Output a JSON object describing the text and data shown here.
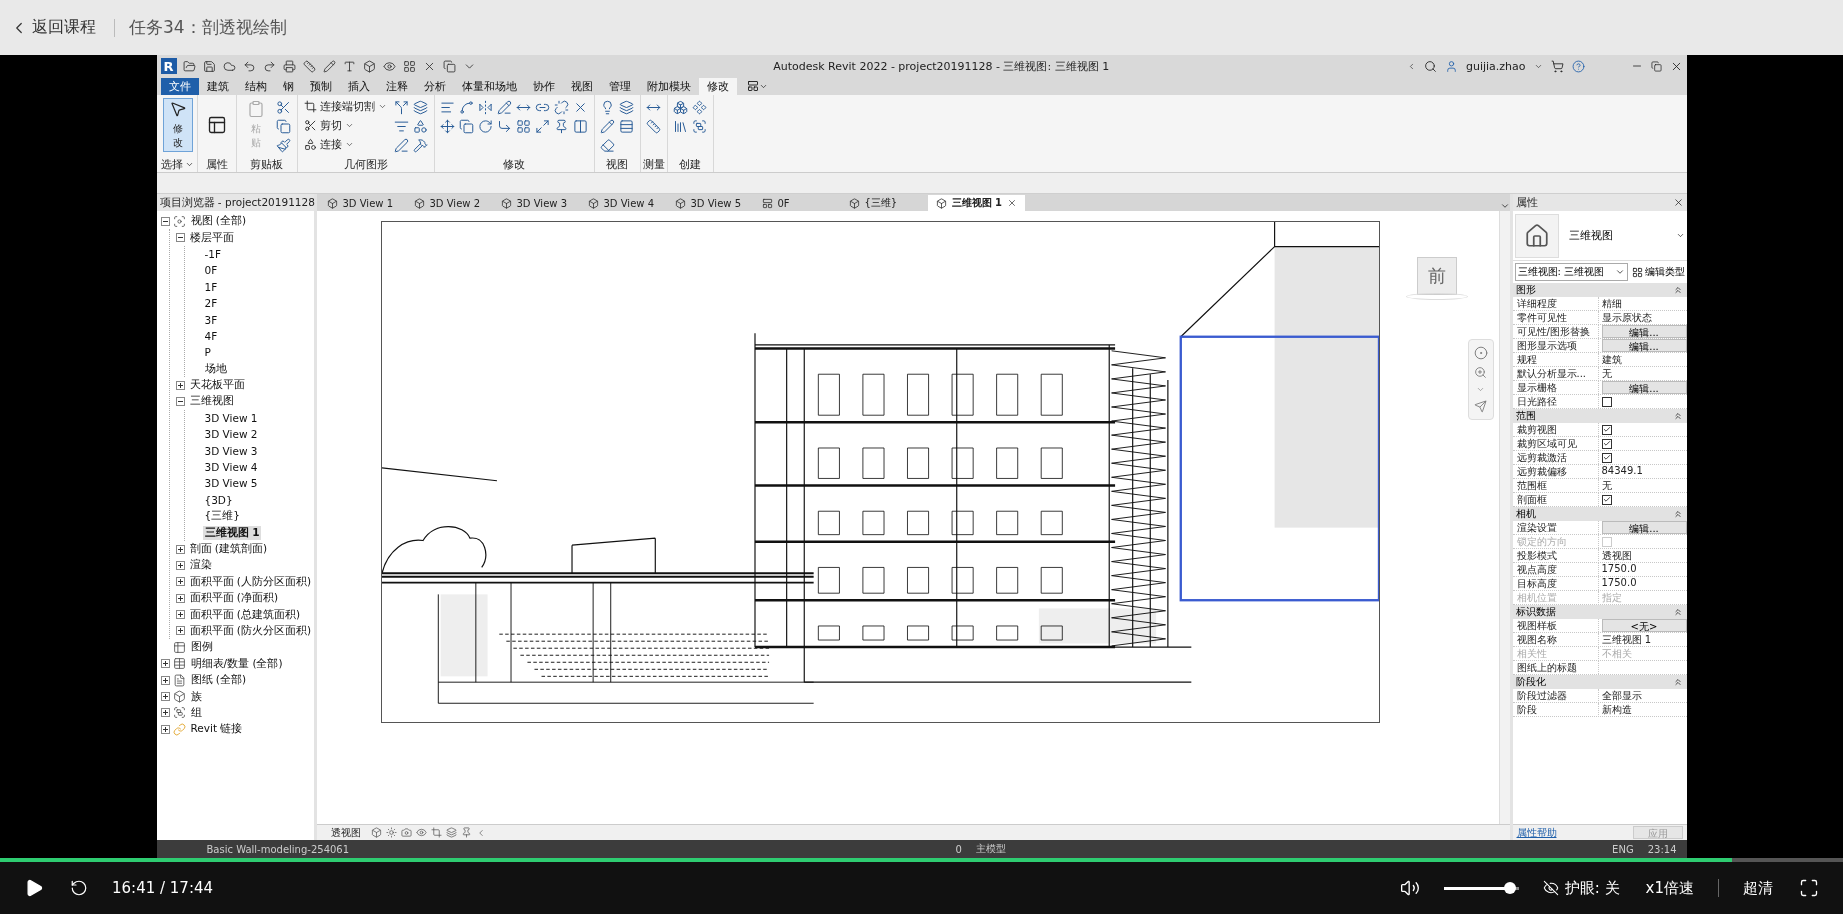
{
  "header": {
    "back": "返回课程",
    "title": "任务34：剖透视绘制"
  },
  "revit": {
    "app_logo": "R",
    "title": "Autodesk Revit 2022 - project20191128 - 三维视图: 三维视图 1",
    "user": "guijia.zhao",
    "menu_tabs": [
      {
        "label": "文件",
        "selected": false
      },
      {
        "label": "建筑",
        "selected": false
      },
      {
        "label": "结构",
        "selected": false
      },
      {
        "label": "钢",
        "selected": false
      },
      {
        "label": "预制",
        "selected": false
      },
      {
        "label": "插入",
        "selected": false
      },
      {
        "label": "注释",
        "selected": false
      },
      {
        "label": "分析",
        "selected": false
      },
      {
        "label": "体量和场地",
        "selected": false
      },
      {
        "label": "协作",
        "selected": false
      },
      {
        "label": "视图",
        "selected": false
      },
      {
        "label": "管理",
        "selected": false
      },
      {
        "label": "附加模块",
        "selected": false
      },
      {
        "label": "修改",
        "selected": true
      }
    ],
    "ribbon_panels": [
      {
        "label": "选择",
        "buttons": [
          {
            "label": "修改",
            "kind": "large",
            "selected": true,
            "disabled": false
          }
        ]
      },
      {
        "label": "属性"
      },
      {
        "label": "剪贴板",
        "buttons": [
          {
            "label": "粘贴",
            "kind": "large",
            "selected": false,
            "disabled": true
          }
        ]
      },
      {
        "label": "几何图形",
        "buttons": [
          {
            "label": "连接端切割",
            "kind": "small"
          },
          {
            "label": "剪切",
            "kind": "small"
          },
          {
            "label": "连接",
            "kind": "small"
          }
        ]
      },
      {
        "label": "修改"
      },
      {
        "label": "视图"
      },
      {
        "label": "测量"
      },
      {
        "label": "创建"
      }
    ],
    "project_browser": {
      "title": "项目浏览器 - project20191128",
      "items": [
        {
          "label": "视图 (全部)",
          "selected": false,
          "expanded": true,
          "children": [
            {
              "label": "楼层平面",
              "selected": false,
              "expanded": true,
              "children": [
                {
                  "label": "-1F",
                  "selected": false
                },
                {
                  "label": "0F",
                  "selected": false
                },
                {
                  "label": "1F",
                  "selected": false
                },
                {
                  "label": "2F",
                  "selected": false
                },
                {
                  "label": "3F",
                  "selected": false
                },
                {
                  "label": "4F",
                  "selected": false
                },
                {
                  "label": "P",
                  "selected": false
                },
                {
                  "label": "场地",
                  "selected": false
                }
              ]
            },
            {
              "label": "天花板平面",
              "selected": false,
              "expanded": false
            },
            {
              "label": "三维视图",
              "selected": false,
              "expanded": true,
              "children": [
                {
                  "label": "3D View 1",
                  "selected": false
                },
                {
                  "label": "3D View 2",
                  "selected": false
                },
                {
                  "label": "3D View 3",
                  "selected": false
                },
                {
                  "label": "3D View 4",
                  "selected": false
                },
                {
                  "label": "3D View 5",
                  "selected": false
                },
                {
                  "label": "{3D}",
                  "selected": false
                },
                {
                  "label": "{三维}",
                  "selected": false
                },
                {
                  "label": "三维视图 1",
                  "selected": true
                }
              ]
            },
            {
              "label": "剖面 (建筑剖面)",
              "selected": false,
              "expanded": false
            },
            {
              "label": "渲染",
              "selected": false,
              "expanded": false
            },
            {
              "label": "面积平面 (人防分区面积)",
              "selected": false,
              "expanded": false
            },
            {
              "label": "面积平面 (净面积)",
              "selected": false,
              "expanded": false
            },
            {
              "label": "面积平面 (总建筑面积)",
              "selected": false,
              "expanded": false
            },
            {
              "label": "面积平面 (防火分区面积)",
              "selected": false,
              "expanded": false
            }
          ]
        },
        {
          "label": "图例",
          "selected": false
        },
        {
          "label": "明细表/数量 (全部)",
          "selected": false,
          "expanded": false
        },
        {
          "label": "图纸 (全部)",
          "selected": false,
          "expanded": false
        },
        {
          "label": "族",
          "selected": false,
          "expanded": false
        },
        {
          "label": "组",
          "selected": false,
          "expanded": false
        },
        {
          "label": "Revit 链接",
          "selected": false,
          "expanded": false
        }
      ]
    },
    "view_tabs": [
      {
        "label": "3D View 1",
        "kind": "model",
        "selected": false
      },
      {
        "label": "3D View 2",
        "kind": "model",
        "selected": false
      },
      {
        "label": "3D View 3",
        "kind": "model",
        "selected": false
      },
      {
        "label": "3D View 4",
        "kind": "model",
        "selected": false
      },
      {
        "label": "3D View 5",
        "kind": "model",
        "selected": false
      },
      {
        "label": "0F",
        "kind": "plan",
        "selected": false
      },
      {
        "label": "{三维}",
        "kind": "model",
        "selected": false
      },
      {
        "label": "三维视图 1",
        "kind": "model",
        "selected": true
      }
    ],
    "view_cube": {
      "face": "前"
    },
    "view_control": {
      "label": "透视图"
    },
    "properties": {
      "title": "属性",
      "type_name": "三维视图",
      "instance_selector": "三维视图: 三维视图",
      "edit_type": "编辑类型",
      "groups": [
        {
          "title": "图形",
          "expanded": true,
          "rows": [
            {
              "label": "详细程度",
              "kind": "text",
              "value": "精细",
              "disabled": false
            },
            {
              "label": "零件可见性",
              "kind": "text",
              "value": "显示原状态",
              "disabled": false
            },
            {
              "label": "可见性/图形替换",
              "kind": "button",
              "value": "编辑...",
              "disabled": false
            },
            {
              "label": "图形显示选项",
              "kind": "button",
              "value": "编辑...",
              "disabled": false
            },
            {
              "label": "规程",
              "kind": "text",
              "value": "建筑",
              "disabled": false
            },
            {
              "label": "默认分析显示...",
              "kind": "text",
              "value": "无",
              "disabled": false
            },
            {
              "label": "显示栅格",
              "kind": "button",
              "value": "编辑...",
              "disabled": false
            },
            {
              "label": "日光路径",
              "kind": "checkbox",
              "checked": false,
              "disabled": false
            }
          ]
        },
        {
          "title": "范围",
          "expanded": true,
          "rows": [
            {
              "label": "裁剪视图",
              "kind": "checkbox",
              "checked": true,
              "disabled": false
            },
            {
              "label": "裁剪区域可见",
              "kind": "checkbox",
              "checked": true,
              "disabled": false
            },
            {
              "label": "远剪裁激活",
              "kind": "checkbox",
              "checked": true,
              "disabled": false
            },
            {
              "label": "远剪裁偏移",
              "kind": "text",
              "value": "84349.1",
              "disabled": false
            },
            {
              "label": "范围框",
              "kind": "text",
              "value": "无",
              "disabled": false
            },
            {
              "label": "剖面框",
              "kind": "checkbox",
              "checked": true,
              "disabled": false
            }
          ]
        },
        {
          "title": "相机",
          "expanded": true,
          "rows": [
            {
              "label": "渲染设置",
              "kind": "button",
              "value": "编辑...",
              "disabled": false
            },
            {
              "label": "锁定的方向",
              "kind": "checkbox",
              "checked": false,
              "disabled": true
            },
            {
              "label": "投影模式",
              "kind": "text",
              "value": "透视图",
              "disabled": false
            },
            {
              "label": "视点高度",
              "kind": "text",
              "value": "1750.0",
              "disabled": false
            },
            {
              "label": "目标高度",
              "kind": "text",
              "value": "1750.0",
              "disabled": false
            },
            {
              "label": "相机位置",
              "kind": "text",
              "value": "指定",
              "disabled": true
            }
          ]
        },
        {
          "title": "标识数据",
          "expanded": true,
          "rows": [
            {
              "label": "视图样板",
              "kind": "button",
              "value": "<无>",
              "disabled": false
            },
            {
              "label": "视图名称",
              "kind": "text",
              "value": "三维视图 1",
              "disabled": false
            },
            {
              "label": "相关性",
              "kind": "text",
              "value": "不相关",
              "disabled": true
            },
            {
              "label": "图纸上的标题",
              "kind": "text",
              "disabled": false
            }
          ]
        },
        {
          "title": "阶段化",
          "expanded": true,
          "rows": [
            {
              "label": "阶段过滤器",
              "kind": "text",
              "value": "全部显示",
              "disabled": false
            },
            {
              "label": "阶段",
              "kind": "text",
              "value": "新构造",
              "disabled": false
            }
          ]
        }
      ],
      "help_link": "属性帮助",
      "apply": "应用"
    },
    "status_bar": {
      "message": "Basic Wall-modeling-254061",
      "count": "0",
      "model": "主模型"
    }
  },
  "taskbar": {
    "language": "ENG",
    "time": "23:14"
  },
  "player": {
    "progress": {
      "level": 0.94
    },
    "time": "16:41 / 17:44",
    "volume": {
      "level": 0.95
    },
    "eye_care": "护眼: 关",
    "speed": "x1倍速",
    "quality": "超清"
  }
}
